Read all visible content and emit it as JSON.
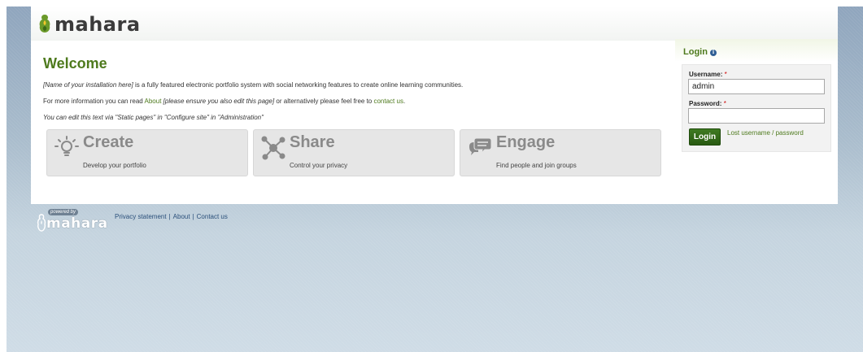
{
  "header": {
    "logo_text": "mahara"
  },
  "welcome": {
    "title": "Welcome",
    "line1_italic": "[Name of your installation here]",
    "line1_rest": " is a fully featured electronic portfolio system with social networking features to create online learning communities.",
    "line2_prefix": "For more information you can read ",
    "line2_about": "About",
    "line2_bracket": " [please ensure you also edit this page]",
    "line2_mid": " or alternatively please feel free to ",
    "line2_contact": "contact us",
    "line2_end": ".",
    "line3": "You can edit this text via \"Static pages\" in \"Configure site\" in \"Administration\""
  },
  "tiles": [
    {
      "title": "Create",
      "subtitle": "Develop your portfolio",
      "icon": "lightbulb-icon"
    },
    {
      "title": "Share",
      "subtitle": "Control your privacy",
      "icon": "share-network-icon"
    },
    {
      "title": "Engage",
      "subtitle": "Find people and join groups",
      "icon": "speech-bubbles-icon"
    }
  ],
  "login": {
    "title": "Login",
    "username_label": "Username:",
    "username_value": "admin",
    "password_label": "Password:",
    "password_value": "",
    "required_marker": "*",
    "submit_label": "Login",
    "lost_link": "Lost username / password"
  },
  "footer": {
    "powered_by": "powered by",
    "logo_text": "mahara",
    "links": [
      "Privacy statement",
      "About",
      "Contact us"
    ],
    "separator": "|"
  },
  "colors": {
    "brand_green": "#4e7a1d",
    "button_green": "#336b1a",
    "link_blue": "#2a4f7a",
    "required_red": "#cc0000"
  }
}
